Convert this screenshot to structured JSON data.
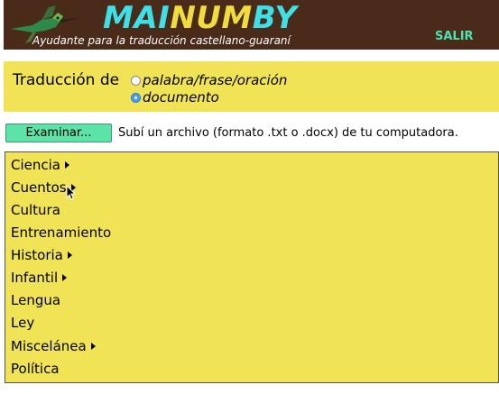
{
  "header": {
    "brand_part1": "MAI",
    "brand_part2": "NUM",
    "brand_part3": "BY",
    "tagline": "Ayudante para la traducción castellano-guaraní",
    "logout_label": "SALIR"
  },
  "translation": {
    "label": "Traducción de",
    "options": [
      {
        "label": "palabra/frase/oración",
        "selected": false
      },
      {
        "label": "documento",
        "selected": true
      }
    ]
  },
  "upload": {
    "browse_label": "Examinar...",
    "hint": "Subí un archivo (formato .txt o .docx) de tu computadora."
  },
  "categories": [
    {
      "label": "Ciencia",
      "has_submenu": true
    },
    {
      "label": "Cuentos",
      "has_submenu": true
    },
    {
      "label": "Cultura",
      "has_submenu": false
    },
    {
      "label": "Entrenamiento",
      "has_submenu": false
    },
    {
      "label": "Historia",
      "has_submenu": true
    },
    {
      "label": "Infantil",
      "has_submenu": true
    },
    {
      "label": "Lengua",
      "has_submenu": false
    },
    {
      "label": "Ley",
      "has_submenu": false
    },
    {
      "label": "Miscelánea",
      "has_submenu": true
    },
    {
      "label": "Política",
      "has_submenu": false
    }
  ],
  "colors": {
    "header_bg": "#4a2a18",
    "brand_cyan": "#3ee0e8",
    "brand_yellow": "#f0dc3c",
    "panel_yellow": "#f1e356",
    "button_green": "#5be3a8"
  }
}
